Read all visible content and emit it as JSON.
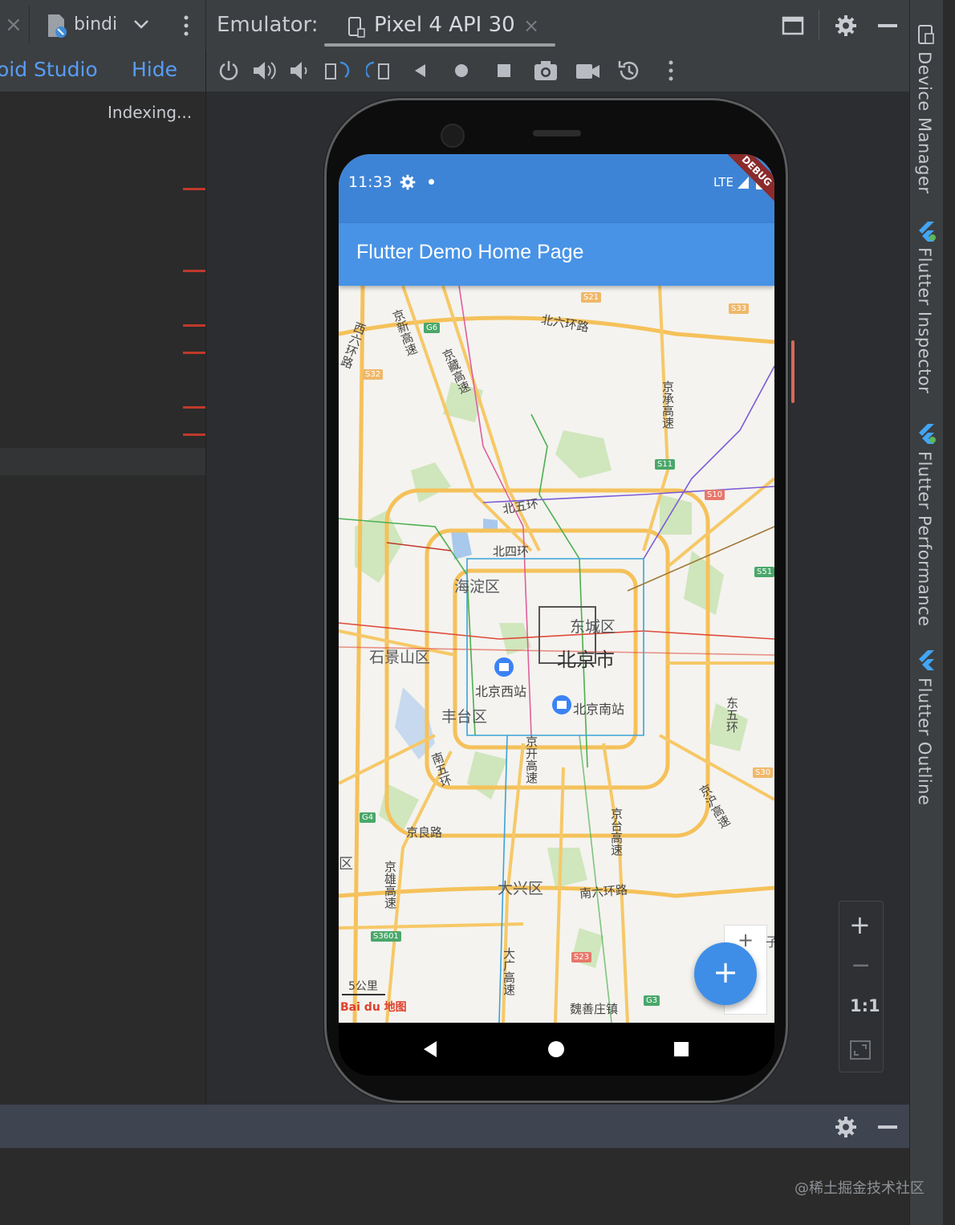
{
  "topbar": {
    "close_glyph": "×",
    "config_name": "bindi",
    "emulator_label": "Emulator:",
    "device_tab": "Pixel 4 API 30",
    "device_tab_close": "×"
  },
  "left_panel": {
    "notice_text": "oid Studio",
    "hide_link": "Hide",
    "indexing": "Indexing..."
  },
  "right_sidebar": {
    "tabs": [
      "Device Manager",
      "Flutter Inspector",
      "Flutter Performance",
      "Flutter Outline"
    ]
  },
  "phone": {
    "time": "11:33",
    "network": "LTE",
    "debug_banner": "DEBUG",
    "app_title": "Flutter Demo Home Page",
    "fab_label": "+",
    "map": {
      "districts": [
        "海淀区",
        "东城区",
        "北京市",
        "石景山区",
        "丰台区",
        "大兴区"
      ],
      "stations": [
        "北京西站",
        "北京南站"
      ],
      "roads": [
        "北六环路",
        "北五环",
        "北四环",
        "京良路",
        "南六环路",
        "京新高速",
        "京藏高速",
        "京承高速",
        "西六环路",
        "东五环",
        "南五环",
        "京开高速",
        "京台高速",
        "京雄高速",
        "京沪高速",
        "大广高速"
      ],
      "places": [
        "魏善庄镇"
      ],
      "shields": [
        "G6",
        "S11",
        "S51",
        "G4",
        "S3601",
        "G3",
        "S32",
        "S33",
        "S10",
        "S21",
        "S23",
        "S30"
      ],
      "scale": "5公里",
      "logo": "Bai du 地图",
      "partial_left": "区",
      "partial_right": "子"
    }
  },
  "zoom_controls": {
    "zoom_in": "+",
    "zoom_out": "−",
    "one_to_one": "1:1"
  },
  "watermark": "@稀土掘金技术社区",
  "colors": {
    "ide_bg": "#2b2d30",
    "toolbar": "#3c3f41",
    "link_blue": "#589df6",
    "appbar_blue": "#4893e6",
    "fab_blue": "#3e8ee8"
  }
}
